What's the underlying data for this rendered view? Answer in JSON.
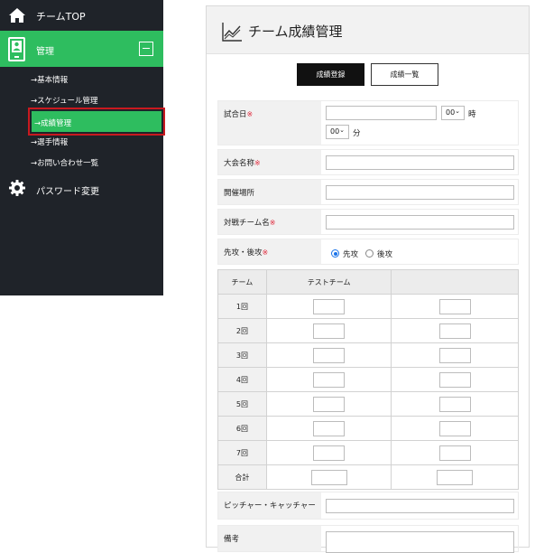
{
  "sidebar": {
    "top_label": "チームTOP",
    "section_label": "管理",
    "sub_items": [
      "→基本情報",
      "→スケジュール管理",
      "→成績管理",
      "→選手情報",
      "→お問い合わせ一覧"
    ],
    "active_sub": "→成績管理",
    "password_label": "パスワード変更",
    "accent_color": "#2ebd5f",
    "highlight_color": "#c8191f",
    "bg_color": "#1f2329"
  },
  "panel": {
    "title": "チーム成績管理",
    "btn_register": "成績登録",
    "btn_list": "成績一覧"
  },
  "form": {
    "date_label": "試合日",
    "required_mark": "※",
    "hour_value": "00",
    "hour_unit": "時",
    "minute_value": "00",
    "minute_unit": "分",
    "tournament_label": "大会名称",
    "venue_label": "開催場所",
    "opponent_label": "対戦チーム名",
    "order_label": "先攻・後攻",
    "order_first": "先攻",
    "order_second": "後攻",
    "battery_label": "ピッチャー・キャッチャー",
    "notes_label": "備考"
  },
  "score_table": {
    "col_team": "チーム",
    "col_home": "テストチーム",
    "col_away": "",
    "innings": [
      "1回",
      "2回",
      "3回",
      "4回",
      "5回",
      "6回",
      "7回"
    ],
    "total_label": "合計"
  }
}
